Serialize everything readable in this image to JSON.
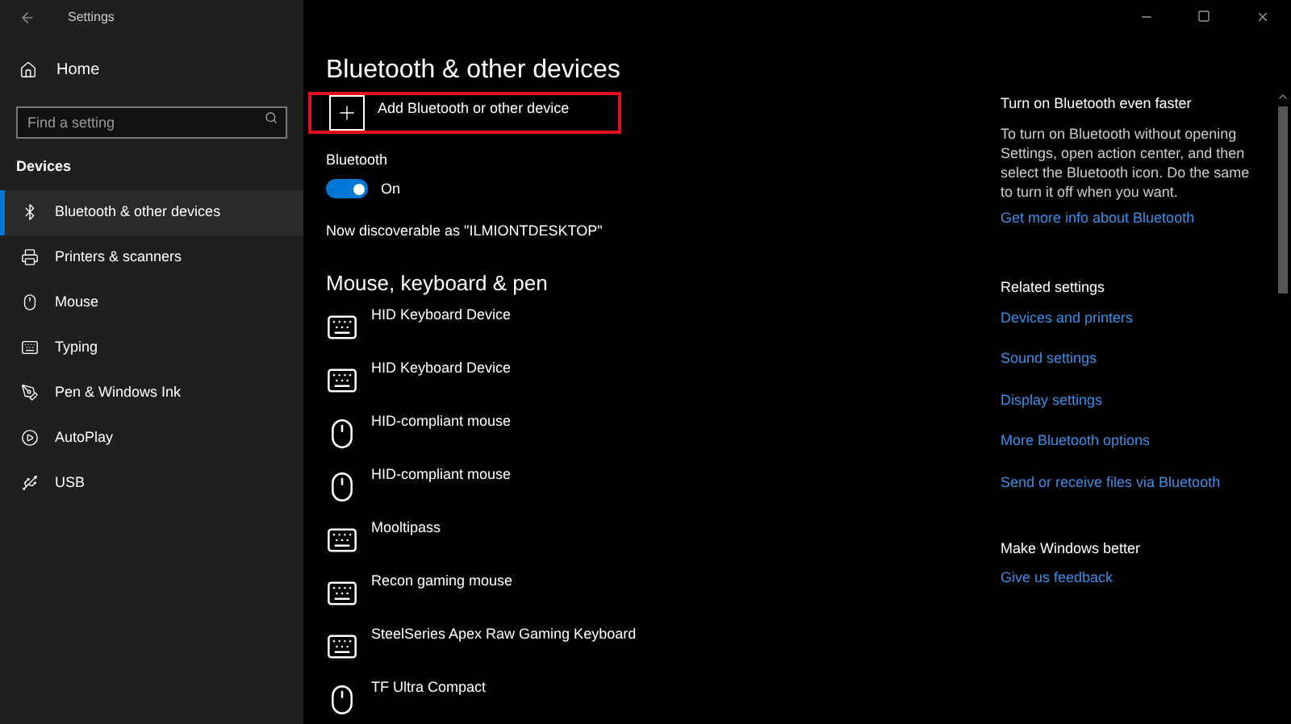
{
  "window": {
    "title": "Settings"
  },
  "sidebar": {
    "home": "Home",
    "search": {
      "placeholder": "Find a setting"
    },
    "section": "Devices",
    "items": [
      {
        "label": "Bluetooth & other devices",
        "kind": "bluetooth",
        "selected": true
      },
      {
        "label": "Printers & scanners",
        "kind": "printer",
        "selected": false
      },
      {
        "label": "Mouse",
        "kind": "mouse",
        "selected": false
      },
      {
        "label": "Typing",
        "kind": "keyboard",
        "selected": false
      },
      {
        "label": "Pen & Windows Ink",
        "kind": "pen",
        "selected": false
      },
      {
        "label": "AutoPlay",
        "kind": "autoplay",
        "selected": false
      },
      {
        "label": "USB",
        "kind": "usb",
        "selected": false
      }
    ]
  },
  "main": {
    "title": "Bluetooth & other devices",
    "add_button": {
      "label": "Add Bluetooth or other device",
      "highlighted": true
    },
    "bluetooth": {
      "label": "Bluetooth",
      "on": true,
      "state_text": "On"
    },
    "discoverable": "Now discoverable as \"ILMIONTDESKTOP\"",
    "section": "Mouse, keyboard & pen",
    "devices": [
      {
        "name": "HID Keyboard Device",
        "kind": "keyboard"
      },
      {
        "name": "HID Keyboard Device",
        "kind": "keyboard"
      },
      {
        "name": "HID-compliant mouse",
        "kind": "mouse"
      },
      {
        "name": "HID-compliant mouse",
        "kind": "mouse"
      },
      {
        "name": "Mooltipass",
        "kind": "keyboard"
      },
      {
        "name": "Recon gaming mouse",
        "kind": "keyboard"
      },
      {
        "name": "SteelSeries Apex Raw Gaming Keyboard",
        "kind": "keyboard"
      },
      {
        "name": "TF Ultra Compact",
        "kind": "mouse"
      }
    ]
  },
  "aside": {
    "tip_title": "Turn on Bluetooth even faster",
    "tip_text": "To turn on Bluetooth without opening Settings, open action center, and then select the Bluetooth icon. Do the same to turn it off when you want.",
    "tip_link": "Get more info about Bluetooth",
    "related_title": "Related settings",
    "related_links": [
      "Devices and printers",
      "Sound settings",
      "Display settings",
      "More Bluetooth options",
      "Send or receive files via Bluetooth"
    ],
    "feedback_title": "Make Windows better",
    "feedback_link": "Give us feedback"
  }
}
